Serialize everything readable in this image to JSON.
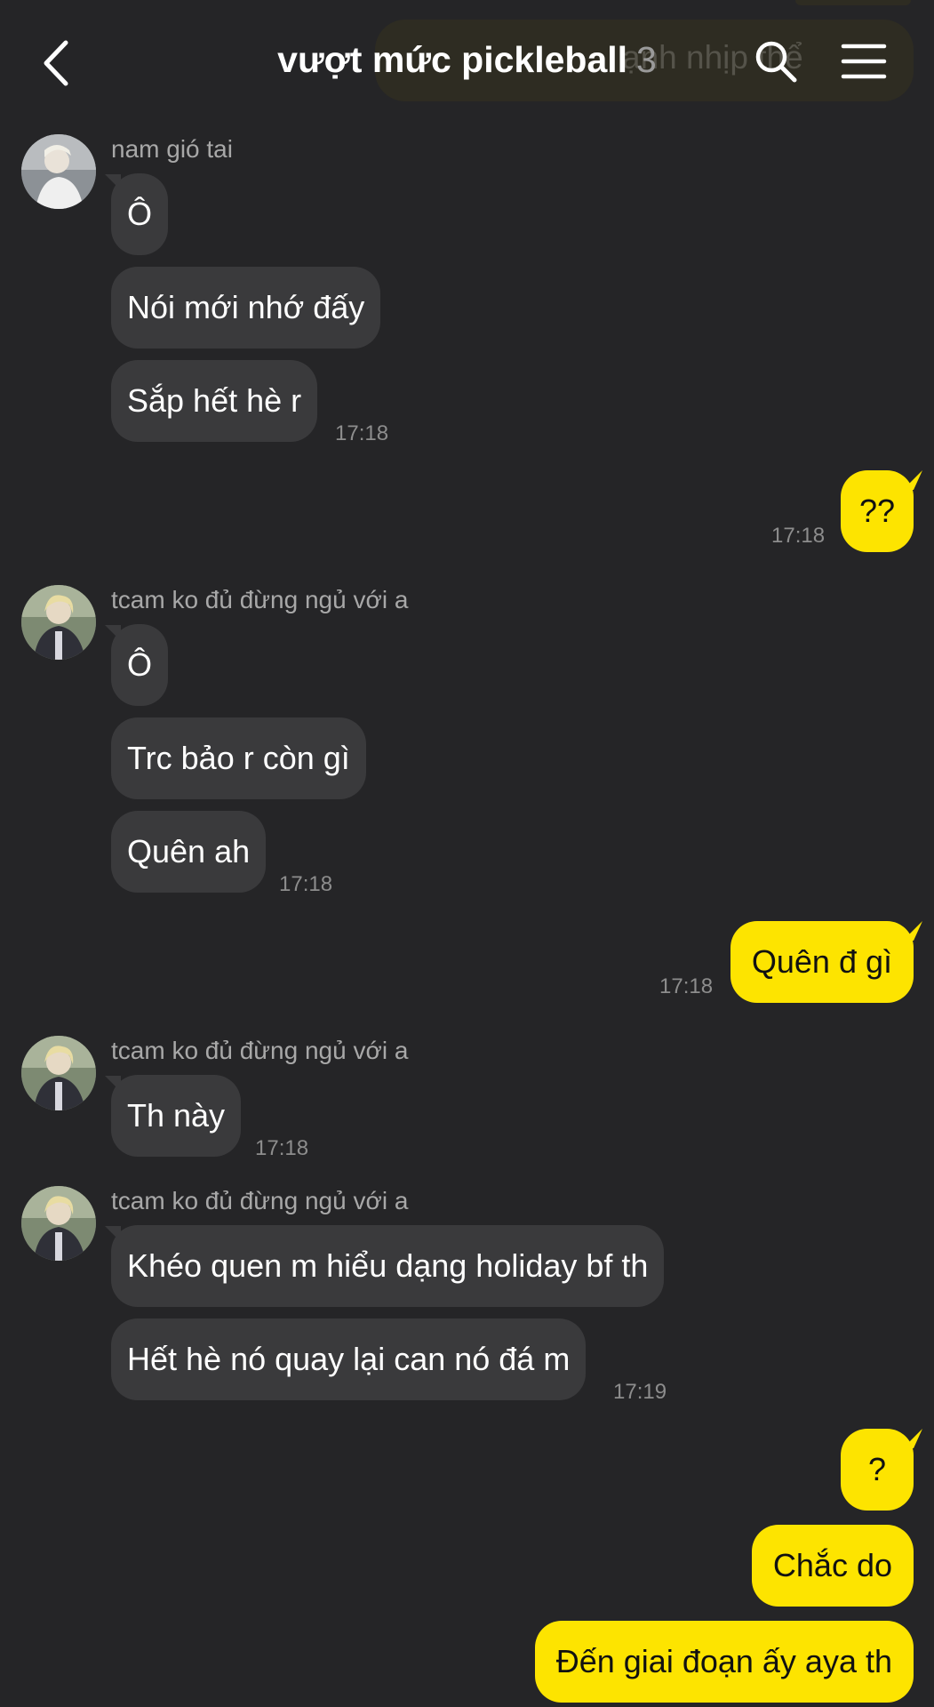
{
  "header": {
    "title": "vượt mức pickleball",
    "member_count": "3",
    "back_icon": "chevron-left-icon",
    "search_icon": "search-icon",
    "menu_icon": "hamburger-menu-icon",
    "peek_text": "ạnh nhịp thể"
  },
  "colors": {
    "background": "#252527",
    "incoming_bubble": "#3a3a3c",
    "outgoing_bubble": "#fde400",
    "timestamp": "#8d8d8d"
  },
  "messages": [
    {
      "sender": "nam gió tai",
      "bubbles": [
        "Ô",
        "Nói mới nhớ đấy",
        "Sắp hết hè r"
      ],
      "time": "17:18"
    },
    {
      "out": [
        "??"
      ],
      "time": "17:18"
    },
    {
      "sender": "tcam ko đủ đừng ngủ với a",
      "bubbles": [
        "Ô",
        "Trc bảo r còn gì",
        "Quên ah"
      ],
      "time": "17:18"
    },
    {
      "out": [
        "Quên đ gì"
      ],
      "time": "17:18"
    },
    {
      "sender": "tcam ko đủ đừng ngủ với a",
      "bubbles": [
        "Th này"
      ],
      "time": "17:18"
    },
    {
      "sender": "tcam ko đủ đừng ngủ với a",
      "bubbles": [
        "Khéo quen m hiểu dạng holiday bf th",
        "Hết hè nó quay lại can nó đá m"
      ],
      "time": "17:19"
    },
    {
      "out": [
        "?",
        "Chắc do",
        "Đến giai đoạn ấy aya th"
      ]
    }
  ]
}
